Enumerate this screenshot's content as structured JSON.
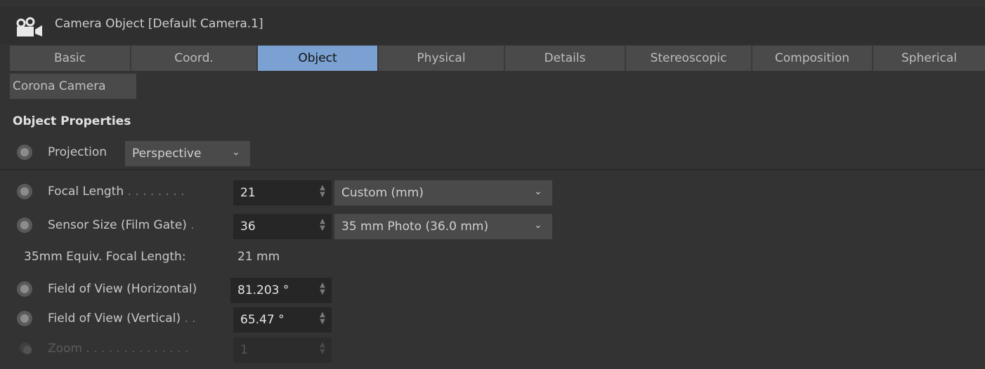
{
  "window": {
    "title": "Camera Object [Default Camera.1]",
    "icon": "camera-icon"
  },
  "tabs": [
    {
      "label": "Basic",
      "active": false
    },
    {
      "label": "Coord.",
      "active": false
    },
    {
      "label": "Object",
      "active": true
    },
    {
      "label": "Physical",
      "active": false
    },
    {
      "label": "Details",
      "active": false
    },
    {
      "label": "Stereoscopic",
      "active": false
    },
    {
      "label": "Composition",
      "active": false
    },
    {
      "label": "Spherical",
      "active": false
    }
  ],
  "tab_row2": {
    "label": "Corona Camera"
  },
  "section": {
    "title": "Object Properties"
  },
  "projection": {
    "label": "Projection",
    "value": "Perspective"
  },
  "focal_length": {
    "label": "Focal Length",
    "dots": " . . . . . . . .",
    "value": "21",
    "preset": "Custom (mm)"
  },
  "sensor_size": {
    "label": "Sensor Size (Film Gate)",
    "dots": " .",
    "value": "36",
    "preset": "35 mm Photo (36.0 mm)"
  },
  "equiv_focal": {
    "label": "35mm Equiv. Focal Length:",
    "value": "21 mm"
  },
  "fov_h": {
    "label": "Field of View (Horizontal)",
    "value": "81.203 °"
  },
  "fov_v": {
    "label": "Field of View (Vertical)",
    "dots": " . .",
    "value": "65.47 °"
  },
  "zoom": {
    "label": "Zoom",
    "dots": " . . . . . . . . . . . . . .",
    "value": "1"
  },
  "colors": {
    "accent_tab": "#7aa1d2",
    "background": "#333333"
  }
}
